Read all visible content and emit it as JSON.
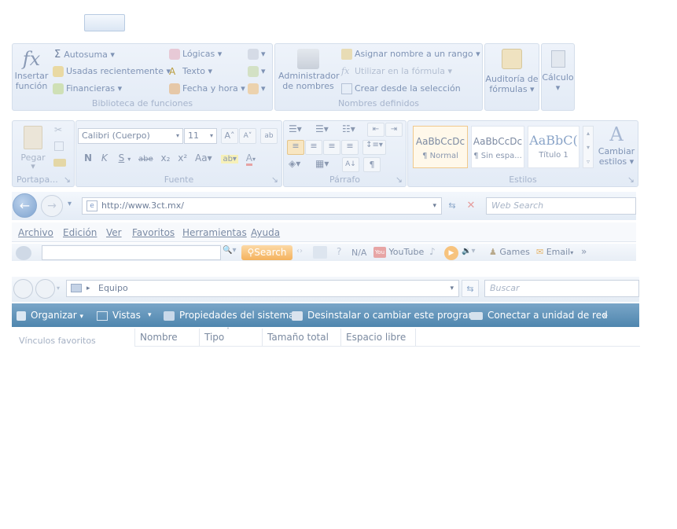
{
  "top_button": {
    "label": ""
  },
  "formulas_ribbon": {
    "insert_function": "Insertar función",
    "insert_function_line1": "Insertar",
    "insert_function_line2": "función",
    "autosum": "Autosuma",
    "recent": "Usadas recientemente",
    "financial": "Financieras",
    "logical": "Lógicas",
    "text": "Texto",
    "datetime": "Fecha y hora",
    "group_library": "Biblioteca de funciones",
    "name_manager_line1": "Administrador",
    "name_manager_line2": "de nombres",
    "assign_name": "Asignar nombre a un rango",
    "use_in_formula": "Utilizar en la fórmula",
    "create_from_selection": "Crear desde la selección",
    "group_names": "Nombres definidos",
    "audit_line1": "Auditoría de",
    "audit_line2": "fórmulas",
    "calc": "Cálculo"
  },
  "home_ribbon": {
    "paste": "Pegar",
    "group_clipboard": "Portapa...",
    "font_name": "Calibri (Cuerpo)",
    "font_size": "11",
    "group_font": "Fuente",
    "group_paragraph": "Párrafo",
    "styles": [
      {
        "sample": "AaBbCcDc",
        "name": "¶ Normal"
      },
      {
        "sample": "AaBbCcDc",
        "name": "¶ Sin espa..."
      },
      {
        "sample": "AaBbC(",
        "name": "Título 1"
      }
    ],
    "change_styles_line1": "Cambiar",
    "change_styles_line2": "estilos",
    "group_styles": "Estilos"
  },
  "ie": {
    "url": "http://www.3ct.mx/",
    "search_placeholder": "Web Search",
    "menu": [
      "Archivo",
      "Edición",
      "Ver",
      "Favoritos",
      "Herramientas",
      "Ayuda"
    ],
    "search_button": "Search",
    "na": "N/A",
    "youtube": "YouTube",
    "games": "Games",
    "email": "Email"
  },
  "explorer": {
    "path": "Equipo",
    "search_placeholder": "Buscar",
    "commands": {
      "organize": "Organizar",
      "views": "Vistas",
      "system_properties": "Propiedades del sistema",
      "uninstall": "Desinstalar o cambiar este programa",
      "map_drive": "Conectar a unidad de red",
      "more": "»"
    },
    "favorites": "Vínculos favoritos",
    "columns": [
      "Nombre",
      "Tipo",
      "Tamaño total",
      "Espacio libre"
    ]
  }
}
